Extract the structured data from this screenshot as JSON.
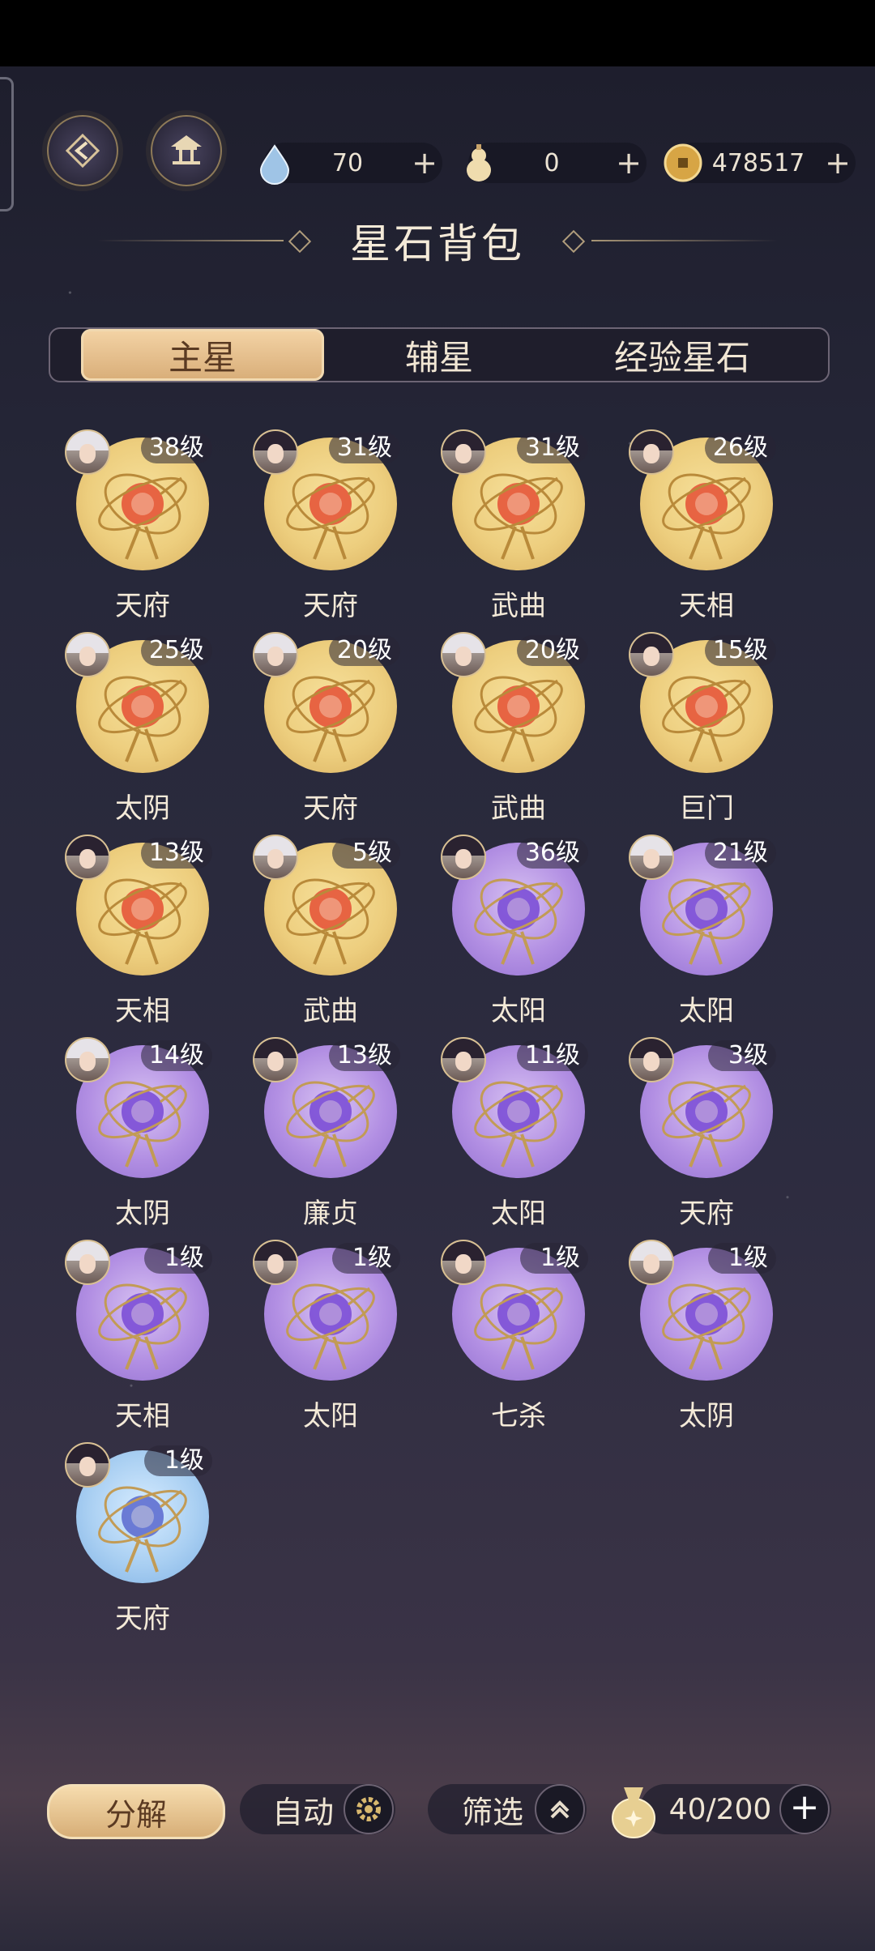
{
  "header": {
    "title": "星石背包",
    "resources": [
      {
        "icon": "water-drop-icon",
        "value": "70"
      },
      {
        "icon": "gourd-icon",
        "value": "0"
      },
      {
        "icon": "coin-icon",
        "value": "478517"
      }
    ],
    "plus": "+"
  },
  "tabs": [
    {
      "label": "主星",
      "active": true
    },
    {
      "label": "辅星",
      "active": false
    },
    {
      "label": "经验星石",
      "active": false
    }
  ],
  "items": [
    {
      "level": "38级",
      "name": "天府",
      "rarity": "gold",
      "avatar": "silver"
    },
    {
      "level": "31级",
      "name": "天府",
      "rarity": "gold",
      "avatar": "dark"
    },
    {
      "level": "31级",
      "name": "武曲",
      "rarity": "gold",
      "avatar": "dark"
    },
    {
      "level": "26级",
      "name": "天相",
      "rarity": "gold",
      "avatar": "dark"
    },
    {
      "level": "25级",
      "name": "太阴",
      "rarity": "gold",
      "avatar": "silver"
    },
    {
      "level": "20级",
      "name": "天府",
      "rarity": "gold",
      "avatar": "silver"
    },
    {
      "level": "20级",
      "name": "武曲",
      "rarity": "gold",
      "avatar": "silver"
    },
    {
      "level": "15级",
      "name": "巨门",
      "rarity": "gold",
      "avatar": "dark"
    },
    {
      "level": "13级",
      "name": "天相",
      "rarity": "gold",
      "avatar": "dark"
    },
    {
      "level": "5级",
      "name": "武曲",
      "rarity": "gold",
      "avatar": "silver"
    },
    {
      "level": "36级",
      "name": "太阳",
      "rarity": "purple",
      "avatar": "dark"
    },
    {
      "level": "21级",
      "name": "太阳",
      "rarity": "purple",
      "avatar": "silver"
    },
    {
      "level": "14级",
      "name": "太阴",
      "rarity": "purple",
      "avatar": "silver"
    },
    {
      "level": "13级",
      "name": "廉贞",
      "rarity": "purple",
      "avatar": "dark"
    },
    {
      "level": "11级",
      "name": "太阳",
      "rarity": "purple",
      "avatar": "dark"
    },
    {
      "level": "3级",
      "name": "天府",
      "rarity": "purple",
      "avatar": "dark"
    },
    {
      "level": "1级",
      "name": "天相",
      "rarity": "purple",
      "avatar": "silver"
    },
    {
      "level": "1级",
      "name": "太阳",
      "rarity": "purple",
      "avatar": "dark"
    },
    {
      "level": "1级",
      "name": "七杀",
      "rarity": "purple",
      "avatar": "dark"
    },
    {
      "level": "1级",
      "name": "太阴",
      "rarity": "purple",
      "avatar": "silver"
    },
    {
      "level": "1级",
      "name": "天府",
      "rarity": "blue",
      "avatar": "dark"
    }
  ],
  "footer": {
    "decompose_label": "分解",
    "auto_label": "自动",
    "filter_label": "筛选",
    "capacity": "40/200",
    "plus": "+"
  },
  "colors": {
    "accent": "#d8ad78",
    "text": "#f4ead8"
  }
}
